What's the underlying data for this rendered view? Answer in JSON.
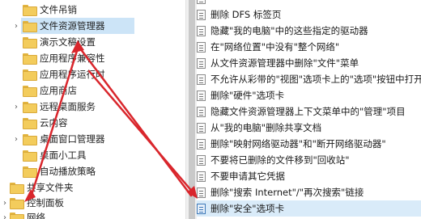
{
  "tree": {
    "items": [
      {
        "label": "文件吊销",
        "expandable": false
      },
      {
        "label": "文件资源管理器",
        "expandable": true,
        "selected": true
      },
      {
        "label": "演示文稿设置",
        "expandable": false
      },
      {
        "label": "应用程序兼容性",
        "expandable": false
      },
      {
        "label": "应用程序运行时",
        "expandable": false
      },
      {
        "label": "应用商店",
        "expandable": false
      },
      {
        "label": "远程桌面服务",
        "expandable": true
      },
      {
        "label": "云内容",
        "expandable": false
      },
      {
        "label": "桌面窗口管理器",
        "expandable": true
      },
      {
        "label": "桌面小工具",
        "expandable": false
      },
      {
        "label": "自动播放策略",
        "expandable": false
      },
      {
        "label": "共享文件夹",
        "expandable": false
      },
      {
        "label": "控制面板",
        "expandable": true
      },
      {
        "label": "网络",
        "expandable": true
      }
    ]
  },
  "policies": {
    "items": [
      {
        "label": "删除 DFS 标签页"
      },
      {
        "label": "隐藏\"我的电脑\"中的这些指定的驱动器"
      },
      {
        "label": "在\"网络位置\"中没有\"整个网络\""
      },
      {
        "label": "从文件资源管理器中删除\"文件\"菜单"
      },
      {
        "label": "不允许从彩带的\"视图\"选项卡上的\"选项\"按钮中打开"
      },
      {
        "label": "删除\"硬件\"选项卡"
      },
      {
        "label": "隐藏文件资源管理器上下文菜单中的\"管理\"项目"
      },
      {
        "label": "从\"我的电脑\"删除共享文档"
      },
      {
        "label": "删除\"映射网络驱动器\"和\"断开网络驱动器\""
      },
      {
        "label": "不要将已删除的文件移到\"回收站\""
      },
      {
        "label": "不要申请其它凭据"
      },
      {
        "label": "删除\"搜索 Internet\"/\"再次搜索\"链接"
      },
      {
        "label": "删除\"安全\"选项卡",
        "selected": true
      }
    ]
  },
  "colors": {
    "annotation_arrow": "#d9262c",
    "selection": "#cce4f7",
    "folder": "#f3cc5c"
  }
}
